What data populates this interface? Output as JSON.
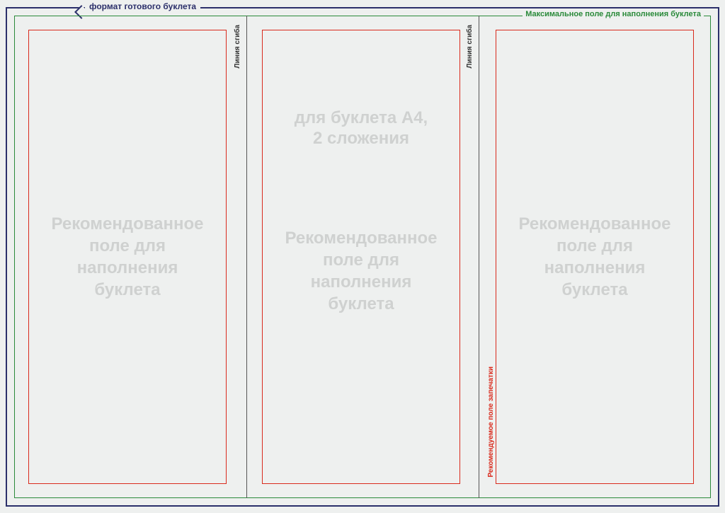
{
  "navy_label": "формат готового буклета",
  "green_label": "Максимальное поле для наполнения буклета",
  "fold_label": "Линия сгиба",
  "red_label": "Рекомендуемое поле запечатки",
  "headline_line1": "для буклета А4,",
  "headline_line2": "2 сложения",
  "rec_line1": "Рекомендованное",
  "rec_line2": "поле для",
  "rec_line3": "наполнения",
  "rec_line4": "буклета"
}
